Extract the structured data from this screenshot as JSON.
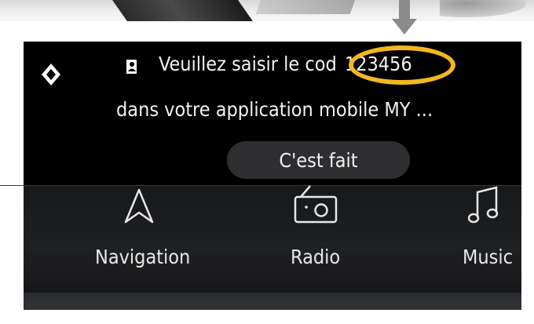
{
  "notification": {
    "message_line1": "Veuillez saisir le cod",
    "code": "123456",
    "message_line2": "dans votre application mobile MY ...",
    "done_button": "C'est fait"
  },
  "launcher": {
    "items": [
      {
        "label": "Navigation",
        "icon": "navigation-arrow-icon"
      },
      {
        "label": "Radio",
        "icon": "radio-icon"
      },
      {
        "label": "Music",
        "icon": "music-note-icon"
      }
    ]
  },
  "colors": {
    "highlight_ring": "#f3b71f",
    "annotation_arrow": "#8b8b8b",
    "panel_background": "#000000",
    "button_background": "#2e2e30"
  }
}
